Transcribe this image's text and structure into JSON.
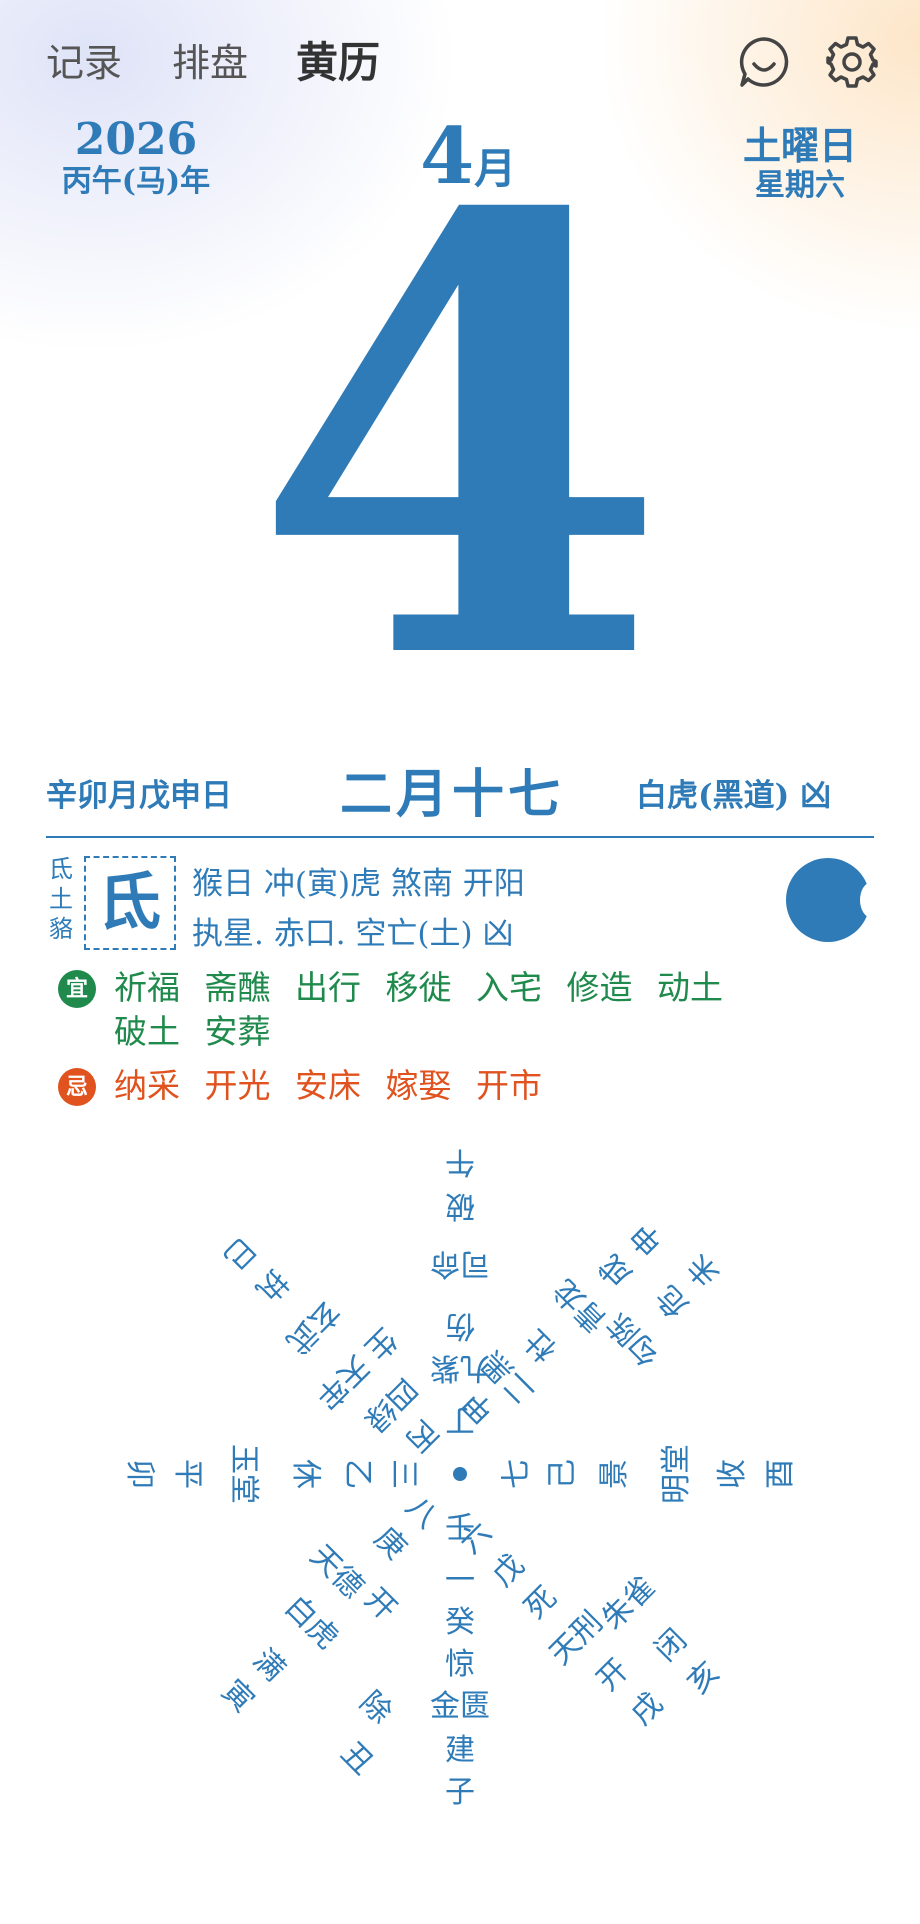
{
  "nav": {
    "items": [
      "记录",
      "排盘",
      "黄历"
    ],
    "active_index": 2
  },
  "icons": {
    "chat": "smiley-chat-icon",
    "settings": "gear-icon"
  },
  "header": {
    "year": "2026",
    "ganzhi_year": "丙午(马)年",
    "month_num": "4",
    "month_unit": "月",
    "weekday_jp": "土曜日",
    "weekday_cn": "星期六"
  },
  "day": "4",
  "info_row": {
    "left": "辛卯月戊申日",
    "lunar": "二月十七",
    "right": "白虎(黑道) 凶"
  },
  "mansion": {
    "small": "氐土貉",
    "char": "氐"
  },
  "lines": {
    "line1": "猴日  冲(寅)虎  煞南  开阳",
    "line2": "执星. 赤口. 空亡(土) 凶"
  },
  "yi": {
    "badge": "宜",
    "text": "祈福 斋醮 出行 移徙 入宅 修造 动土 破土 安葬"
  },
  "ji": {
    "badge": "忌",
    "text": "纳采 开光 安床 嫁娶 开市"
  },
  "compass_labels": [
    "午",
    "破",
    "司命",
    "伤",
    "九紫",
    "丁",
    "壬",
    "一",
    "癸",
    "惊",
    "金匮",
    "建",
    "子",
    "未",
    "危",
    "勾陈",
    "申",
    "成",
    "青龙",
    "杜",
    "二黑",
    "甲",
    "巳",
    "执",
    "玄武",
    "天牢",
    "生",
    "四绿",
    "丙",
    "酉",
    "收",
    "明堂",
    "景",
    "己",
    "七",
    "卯",
    "平",
    "玉堂",
    "休",
    "乙",
    "三",
    "寅",
    "满",
    "白虎",
    "天德",
    "开",
    "庚",
    "八",
    "丑",
    "除",
    "亥",
    "闭",
    "朱雀",
    "戌",
    "开",
    "天刑",
    "死",
    "戊",
    "六"
  ],
  "colors": {
    "primary": "#2f7bb8",
    "yi": "#1f8a4c",
    "ji": "#e0521e"
  }
}
